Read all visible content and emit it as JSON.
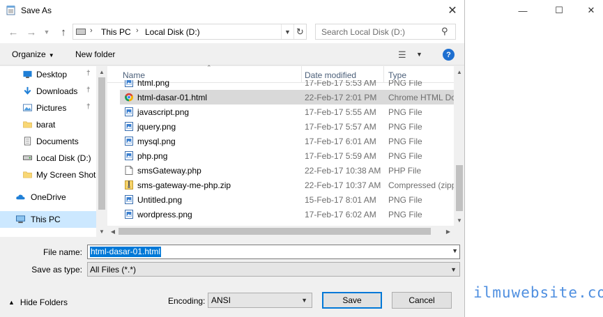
{
  "background_window": {
    "watermark": "ilmuwebsite.com"
  },
  "dialog": {
    "title": "Save As",
    "address": {
      "segments": [
        "This PC",
        "Local Disk (D:)"
      ]
    },
    "search_placeholder": "Search Local Disk (D:)",
    "toolbar": {
      "organize_label": "Organize",
      "new_folder_label": "New folder",
      "help_label": "?"
    },
    "nav_items": [
      {
        "label": "Desktop",
        "icon": "desktop-icon",
        "pinned": true
      },
      {
        "label": "Downloads",
        "icon": "download-icon",
        "pinned": true
      },
      {
        "label": "Pictures",
        "icon": "pictures-icon",
        "pinned": true
      },
      {
        "label": "barat",
        "icon": "folder-icon",
        "pinned": false
      },
      {
        "label": "Documents",
        "icon": "documents-icon",
        "pinned": false
      },
      {
        "label": "Local Disk (D:)",
        "icon": "drive-icon",
        "pinned": false
      },
      {
        "label": "My Screen Shots",
        "icon": "folder-icon",
        "pinned": false
      },
      {
        "label": "OneDrive",
        "icon": "cloud-icon",
        "pinned": false
      },
      {
        "label": "This PC",
        "icon": "computer-icon",
        "pinned": false,
        "selected": true
      }
    ],
    "columns": {
      "name": "Name",
      "date_modified": "Date modified",
      "type": "Type"
    },
    "files": [
      {
        "name": "html.png",
        "date": "17-Feb-17 5:53 AM",
        "type": "PNG File",
        "icon": "png-file-icon"
      },
      {
        "name": "html-dasar-01.html",
        "date": "22-Feb-17 2:01 PM",
        "type": "Chrome HTML Do",
        "icon": "chrome-icon",
        "selected": true
      },
      {
        "name": "javascript.png",
        "date": "17-Feb-17 5:55 AM",
        "type": "PNG File",
        "icon": "png-file-icon"
      },
      {
        "name": "jquery.png",
        "date": "17-Feb-17 5:57 AM",
        "type": "PNG File",
        "icon": "png-file-icon"
      },
      {
        "name": "mysql.png",
        "date": "17-Feb-17 6:01 AM",
        "type": "PNG File",
        "icon": "png-file-icon"
      },
      {
        "name": "php.png",
        "date": "17-Feb-17 5:59 AM",
        "type": "PNG File",
        "icon": "png-file-icon"
      },
      {
        "name": "smsGateway.php",
        "date": "22-Feb-17 10:38 AM",
        "type": "PHP File",
        "icon": "blank-file-icon"
      },
      {
        "name": "sms-gateway-me-php.zip",
        "date": "22-Feb-17 10:37 AM",
        "type": "Compressed (zipp",
        "icon": "zip-file-icon"
      },
      {
        "name": "Untitled.png",
        "date": "15-Feb-17 8:01 AM",
        "type": "PNG File",
        "icon": "png-file-icon"
      },
      {
        "name": "wordpress.png",
        "date": "17-Feb-17 6:02 AM",
        "type": "PNG File",
        "icon": "png-file-icon"
      }
    ],
    "form": {
      "file_name_label": "File name:",
      "file_name_value": "html-dasar-01.html",
      "save_as_type_label": "Save as type:",
      "save_as_type_value": "All Files  (*.*)",
      "hide_folders_label": "Hide Folders",
      "encoding_label": "Encoding:",
      "encoding_value": "ANSI",
      "save_label": "Save",
      "cancel_label": "Cancel"
    }
  }
}
